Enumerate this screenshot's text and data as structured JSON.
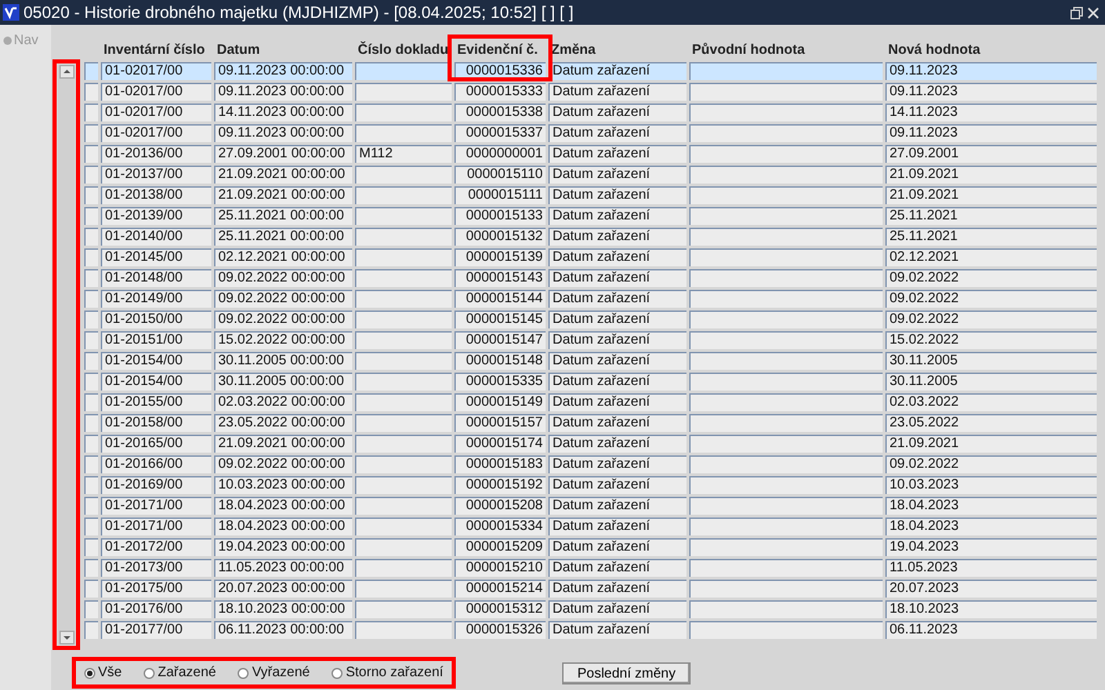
{
  "window": {
    "title": "05020 - Historie drobného majetku (MJDHIZMP) - [08.04.2025; 10:52]  [ ]  [ ]"
  },
  "nav": {
    "label": "Nav"
  },
  "table": {
    "columns": [
      "Inventární číslo",
      "Datum",
      "Číslo dokladu",
      "Evidenční č.",
      "Změna",
      "Původní hodnota",
      "Nová hodnota"
    ],
    "rows": [
      {
        "selected": true,
        "inv": "01-02017/00",
        "datum": "09.11.2023 00:00:00",
        "evid": "0000015336",
        "zmena": "Datum zařazení",
        "nova": "09.11.2023"
      },
      {
        "selected": false,
        "inv": "01-02017/00",
        "datum": "09.11.2023 00:00:00",
        "evid": "0000015333",
        "zmena": "Datum zařazení",
        "nova": "09.11.2023"
      },
      {
        "selected": false,
        "inv": "01-02017/00",
        "datum": "14.11.2023 00:00:00",
        "evid": "0000015338",
        "zmena": "Datum zařazení",
        "nova": "14.11.2023"
      },
      {
        "selected": false,
        "inv": "01-02017/00",
        "datum": "09.11.2023 00:00:00",
        "evid": "0000015337",
        "zmena": "Datum zařazení",
        "nova": "09.11.2023"
      },
      {
        "selected": false,
        "inv": "01-20136/00",
        "datum": "27.09.2001 00:00:00",
        "doklad": "M112",
        "evid": "0000000001",
        "zmena": "Datum zařazení",
        "nova": "27.09.2001"
      },
      {
        "selected": false,
        "inv": "01-20137/00",
        "datum": "21.09.2021 00:00:00",
        "evid": "0000015110",
        "zmena": "Datum zařazení",
        "nova": "21.09.2021"
      },
      {
        "selected": false,
        "inv": "01-20138/00",
        "datum": "21.09.2021 00:00:00",
        "evid": "0000015111",
        "zmena": "Datum zařazení",
        "nova": "21.09.2021"
      },
      {
        "selected": false,
        "inv": "01-20139/00",
        "datum": "25.11.2021 00:00:00",
        "evid": "0000015133",
        "zmena": "Datum zařazení",
        "nova": "25.11.2021"
      },
      {
        "selected": false,
        "inv": "01-20140/00",
        "datum": "25.11.2021 00:00:00",
        "evid": "0000015132",
        "zmena": "Datum zařazení",
        "nova": "25.11.2021"
      },
      {
        "selected": false,
        "inv": "01-20145/00",
        "datum": "02.12.2021 00:00:00",
        "evid": "0000015139",
        "zmena": "Datum zařazení",
        "nova": "02.12.2021"
      },
      {
        "selected": false,
        "inv": "01-20148/00",
        "datum": "09.02.2022 00:00:00",
        "evid": "0000015143",
        "zmena": "Datum zařazení",
        "nova": "09.02.2022"
      },
      {
        "selected": false,
        "inv": "01-20149/00",
        "datum": "09.02.2022 00:00:00",
        "evid": "0000015144",
        "zmena": "Datum zařazení",
        "nova": "09.02.2022"
      },
      {
        "selected": false,
        "inv": "01-20150/00",
        "datum": "09.02.2022 00:00:00",
        "evid": "0000015145",
        "zmena": "Datum zařazení",
        "nova": "09.02.2022"
      },
      {
        "selected": false,
        "inv": "01-20151/00",
        "datum": "15.02.2022 00:00:00",
        "evid": "0000015147",
        "zmena": "Datum zařazení",
        "nova": "15.02.2022"
      },
      {
        "selected": false,
        "inv": "01-20154/00",
        "datum": "30.11.2005 00:00:00",
        "evid": "0000015148",
        "zmena": "Datum zařazení",
        "nova": "30.11.2005"
      },
      {
        "selected": false,
        "inv": "01-20154/00",
        "datum": "30.11.2005 00:00:00",
        "evid": "0000015335",
        "zmena": "Datum zařazení",
        "nova": "30.11.2005"
      },
      {
        "selected": false,
        "inv": "01-20155/00",
        "datum": "02.03.2022 00:00:00",
        "evid": "0000015149",
        "zmena": "Datum zařazení",
        "nova": "02.03.2022"
      },
      {
        "selected": false,
        "inv": "01-20158/00",
        "datum": "23.05.2022 00:00:00",
        "evid": "0000015157",
        "zmena": "Datum zařazení",
        "nova": "23.05.2022"
      },
      {
        "selected": false,
        "inv": "01-20165/00",
        "datum": "21.09.2021 00:00:00",
        "evid": "0000015174",
        "zmena": "Datum zařazení",
        "nova": "21.09.2021"
      },
      {
        "selected": false,
        "inv": "01-20166/00",
        "datum": "09.02.2022 00:00:00",
        "evid": "0000015183",
        "zmena": "Datum zařazení",
        "nova": "09.02.2022"
      },
      {
        "selected": false,
        "inv": "01-20169/00",
        "datum": "10.03.2023 00:00:00",
        "evid": "0000015192",
        "zmena": "Datum zařazení",
        "nova": "10.03.2023"
      },
      {
        "selected": false,
        "inv": "01-20171/00",
        "datum": "18.04.2023 00:00:00",
        "evid": "0000015208",
        "zmena": "Datum zařazení",
        "nova": "18.04.2023"
      },
      {
        "selected": false,
        "inv": "01-20171/00",
        "datum": "18.04.2023 00:00:00",
        "evid": "0000015334",
        "zmena": "Datum zařazení",
        "nova": "18.04.2023"
      },
      {
        "selected": false,
        "inv": "01-20172/00",
        "datum": "19.04.2023 00:00:00",
        "evid": "0000015209",
        "zmena": "Datum zařazení",
        "nova": "19.04.2023"
      },
      {
        "selected": false,
        "inv": "01-20173/00",
        "datum": "11.05.2023 00:00:00",
        "evid": "0000015210",
        "zmena": "Datum zařazení",
        "nova": "11.05.2023"
      },
      {
        "selected": false,
        "inv": "01-20175/00",
        "datum": "20.07.2023 00:00:00",
        "evid": "0000015214",
        "zmena": "Datum zařazení",
        "nova": "20.07.2023"
      },
      {
        "selected": false,
        "inv": "01-20176/00",
        "datum": "18.10.2023 00:00:00",
        "evid": "0000015312",
        "zmena": "Datum zařazení",
        "nova": "18.10.2023"
      },
      {
        "selected": false,
        "inv": "01-20177/00",
        "datum": "06.11.2023 00:00:00",
        "evid": "0000015326",
        "zmena": "Datum zařazení",
        "nova": "06.11.2023"
      }
    ]
  },
  "filters": [
    {
      "label": "Vše",
      "selected": true
    },
    {
      "label": "Zařazené",
      "selected": false
    },
    {
      "label": "Vyřazené",
      "selected": false
    },
    {
      "label": "Storno zařazení",
      "selected": false
    }
  ],
  "buttons": [
    "Poslední změny"
  ]
}
